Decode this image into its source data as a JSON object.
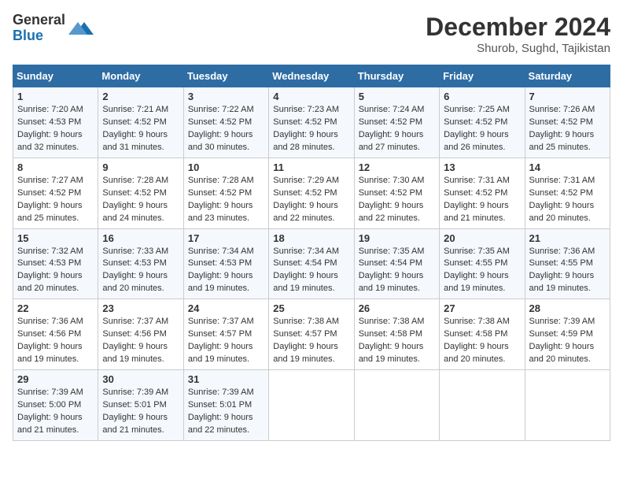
{
  "header": {
    "logo_line1": "General",
    "logo_line2": "Blue",
    "title": "December 2024",
    "subtitle": "Shurob, Sughd, Tajikistan"
  },
  "columns": [
    "Sunday",
    "Monday",
    "Tuesday",
    "Wednesday",
    "Thursday",
    "Friday",
    "Saturday"
  ],
  "weeks": [
    [
      {
        "day": "1",
        "info": "Sunrise: 7:20 AM\nSunset: 4:53 PM\nDaylight: 9 hours\nand 32 minutes."
      },
      {
        "day": "2",
        "info": "Sunrise: 7:21 AM\nSunset: 4:52 PM\nDaylight: 9 hours\nand 31 minutes."
      },
      {
        "day": "3",
        "info": "Sunrise: 7:22 AM\nSunset: 4:52 PM\nDaylight: 9 hours\nand 30 minutes."
      },
      {
        "day": "4",
        "info": "Sunrise: 7:23 AM\nSunset: 4:52 PM\nDaylight: 9 hours\nand 28 minutes."
      },
      {
        "day": "5",
        "info": "Sunrise: 7:24 AM\nSunset: 4:52 PM\nDaylight: 9 hours\nand 27 minutes."
      },
      {
        "day": "6",
        "info": "Sunrise: 7:25 AM\nSunset: 4:52 PM\nDaylight: 9 hours\nand 26 minutes."
      },
      {
        "day": "7",
        "info": "Sunrise: 7:26 AM\nSunset: 4:52 PM\nDaylight: 9 hours\nand 25 minutes."
      }
    ],
    [
      {
        "day": "8",
        "info": "Sunrise: 7:27 AM\nSunset: 4:52 PM\nDaylight: 9 hours\nand 25 minutes."
      },
      {
        "day": "9",
        "info": "Sunrise: 7:28 AM\nSunset: 4:52 PM\nDaylight: 9 hours\nand 24 minutes."
      },
      {
        "day": "10",
        "info": "Sunrise: 7:28 AM\nSunset: 4:52 PM\nDaylight: 9 hours\nand 23 minutes."
      },
      {
        "day": "11",
        "info": "Sunrise: 7:29 AM\nSunset: 4:52 PM\nDaylight: 9 hours\nand 22 minutes."
      },
      {
        "day": "12",
        "info": "Sunrise: 7:30 AM\nSunset: 4:52 PM\nDaylight: 9 hours\nand 22 minutes."
      },
      {
        "day": "13",
        "info": "Sunrise: 7:31 AM\nSunset: 4:52 PM\nDaylight: 9 hours\nand 21 minutes."
      },
      {
        "day": "14",
        "info": "Sunrise: 7:31 AM\nSunset: 4:52 PM\nDaylight: 9 hours\nand 20 minutes."
      }
    ],
    [
      {
        "day": "15",
        "info": "Sunrise: 7:32 AM\nSunset: 4:53 PM\nDaylight: 9 hours\nand 20 minutes."
      },
      {
        "day": "16",
        "info": "Sunrise: 7:33 AM\nSunset: 4:53 PM\nDaylight: 9 hours\nand 20 minutes."
      },
      {
        "day": "17",
        "info": "Sunrise: 7:34 AM\nSunset: 4:53 PM\nDaylight: 9 hours\nand 19 minutes."
      },
      {
        "day": "18",
        "info": "Sunrise: 7:34 AM\nSunset: 4:54 PM\nDaylight: 9 hours\nand 19 minutes."
      },
      {
        "day": "19",
        "info": "Sunrise: 7:35 AM\nSunset: 4:54 PM\nDaylight: 9 hours\nand 19 minutes."
      },
      {
        "day": "20",
        "info": "Sunrise: 7:35 AM\nSunset: 4:55 PM\nDaylight: 9 hours\nand 19 minutes."
      },
      {
        "day": "21",
        "info": "Sunrise: 7:36 AM\nSunset: 4:55 PM\nDaylight: 9 hours\nand 19 minutes."
      }
    ],
    [
      {
        "day": "22",
        "info": "Sunrise: 7:36 AM\nSunset: 4:56 PM\nDaylight: 9 hours\nand 19 minutes."
      },
      {
        "day": "23",
        "info": "Sunrise: 7:37 AM\nSunset: 4:56 PM\nDaylight: 9 hours\nand 19 minutes."
      },
      {
        "day": "24",
        "info": "Sunrise: 7:37 AM\nSunset: 4:57 PM\nDaylight: 9 hours\nand 19 minutes."
      },
      {
        "day": "25",
        "info": "Sunrise: 7:38 AM\nSunset: 4:57 PM\nDaylight: 9 hours\nand 19 minutes."
      },
      {
        "day": "26",
        "info": "Sunrise: 7:38 AM\nSunset: 4:58 PM\nDaylight: 9 hours\nand 19 minutes."
      },
      {
        "day": "27",
        "info": "Sunrise: 7:38 AM\nSunset: 4:58 PM\nDaylight: 9 hours\nand 20 minutes."
      },
      {
        "day": "28",
        "info": "Sunrise: 7:39 AM\nSunset: 4:59 PM\nDaylight: 9 hours\nand 20 minutes."
      }
    ],
    [
      {
        "day": "29",
        "info": "Sunrise: 7:39 AM\nSunset: 5:00 PM\nDaylight: 9 hours\nand 21 minutes."
      },
      {
        "day": "30",
        "info": "Sunrise: 7:39 AM\nSunset: 5:01 PM\nDaylight: 9 hours\nand 21 minutes."
      },
      {
        "day": "31",
        "info": "Sunrise: 7:39 AM\nSunset: 5:01 PM\nDaylight: 9 hours\nand 22 minutes."
      },
      null,
      null,
      null,
      null
    ]
  ]
}
